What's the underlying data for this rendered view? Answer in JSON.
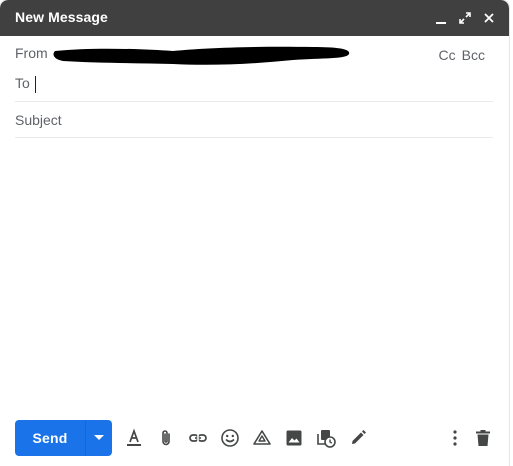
{
  "window": {
    "title": "New Message",
    "controls": [
      "minimize-icon",
      "expand-icon",
      "close-icon"
    ]
  },
  "fields": {
    "from_label": "From",
    "from_value_redacted": true,
    "cc_label": "Cc",
    "bcc_label": "Bcc",
    "to_label": "To",
    "to_value": "",
    "subject_placeholder": "Subject",
    "subject_value": ""
  },
  "toolbar": {
    "send_label": "Send",
    "icons": [
      "text-format-icon",
      "attach-icon",
      "link-icon",
      "emoji-icon",
      "drive-icon",
      "photo-icon",
      "confidential-icon",
      "signature-icon",
      "more-options-icon",
      "delete-icon"
    ]
  },
  "colors": {
    "titlebar": "#404040",
    "send_button": "#1a73e8",
    "label_text": "#5f6368",
    "icon": "#444746"
  }
}
